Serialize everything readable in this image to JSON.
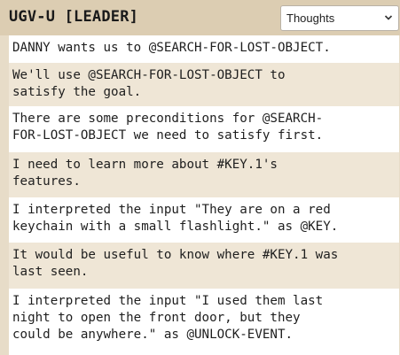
{
  "header": {
    "title": "UGV-U [LEADER]",
    "mode_select": {
      "value": "Thoughts",
      "icon": "chevron-down-icon"
    }
  },
  "messages": [
    "DANNY wants us to @SEARCH-FOR-LOST-OBJECT.",
    "We'll use @SEARCH-FOR-LOST-OBJECT to\nsatisfy the goal.",
    "There are some preconditions for @SEARCH-\nFOR-LOST-OBJECT we need to satisfy first.",
    "I need to learn more about #KEY.1's\nfeatures.",
    "I interpreted the input \"They are on a red\nkeychain with a small flashlight.\" as @KEY.",
    "It would be useful to know where #KEY.1 was\nlast seen.",
    "I interpreted the input \"I used them last\nnight to open the front door, but they\ncould be anywhere.\" as @UNLOCK-EVENT."
  ],
  "colors": {
    "panel_bg": "#e7dcc8",
    "header_bg": "#dccdb2",
    "row_light": "#ffffff",
    "row_tan": "#efe6d6"
  }
}
